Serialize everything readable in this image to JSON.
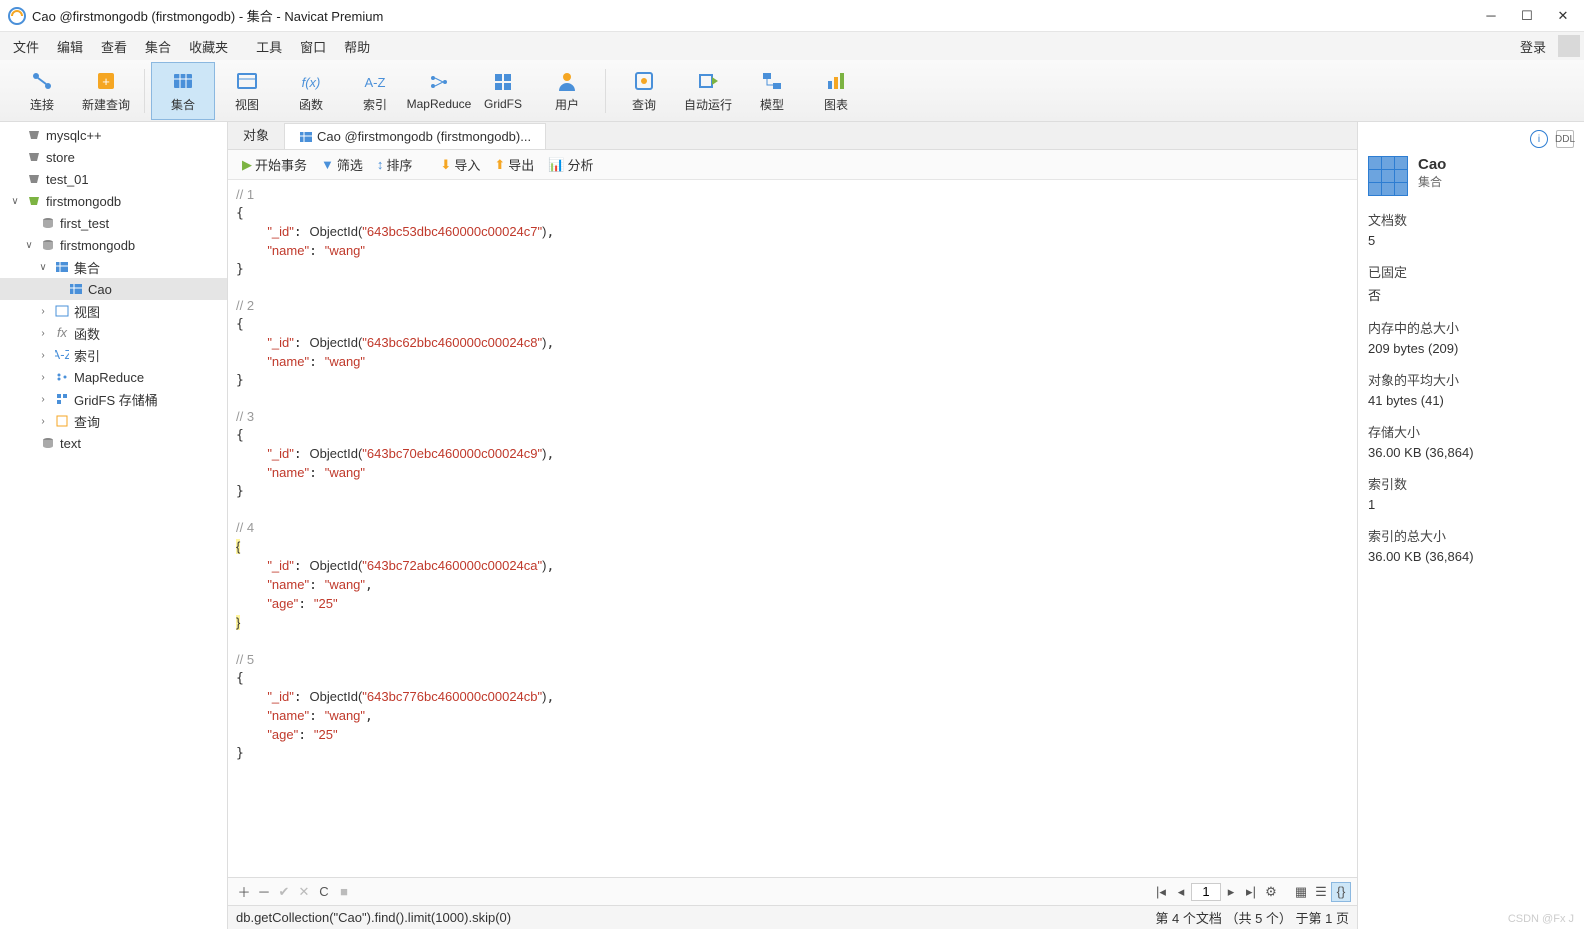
{
  "window": {
    "title": "Cao @firstmongodb (firstmongodb) - 集合 - Navicat Premium"
  },
  "menubar": {
    "items": [
      "文件",
      "编辑",
      "查看",
      "集合",
      "收藏夹",
      "工具",
      "窗口",
      "帮助"
    ],
    "login": "登录"
  },
  "toolbar": [
    {
      "label": "连接",
      "icon": "connection",
      "sep": false
    },
    {
      "label": "新建查询",
      "icon": "query-new",
      "sep": true
    },
    {
      "label": "集合",
      "icon": "collection",
      "active": true,
      "sep": false
    },
    {
      "label": "视图",
      "icon": "view",
      "sep": false
    },
    {
      "label": "函数",
      "icon": "function",
      "sep": false
    },
    {
      "label": "索引",
      "icon": "index",
      "sep": false
    },
    {
      "label": "MapReduce",
      "icon": "mapreduce",
      "sep": false
    },
    {
      "label": "GridFS",
      "icon": "gridfs",
      "sep": false
    },
    {
      "label": "用户",
      "icon": "user",
      "sep": true
    },
    {
      "label": "查询",
      "icon": "query",
      "sep": false
    },
    {
      "label": "自动运行",
      "icon": "autorun",
      "sep": false
    },
    {
      "label": "模型",
      "icon": "model",
      "sep": false
    },
    {
      "label": "图表",
      "icon": "chart",
      "sep": false
    }
  ],
  "tree": [
    {
      "label": "mysqlc++",
      "icon": "server",
      "exp": "",
      "ind": 0
    },
    {
      "label": "store",
      "icon": "server",
      "exp": "",
      "ind": 0
    },
    {
      "label": "test_01",
      "icon": "server",
      "exp": "",
      "ind": 0
    },
    {
      "label": "firstmongodb",
      "icon": "server-mongo",
      "exp": "∨",
      "ind": 0
    },
    {
      "label": "first_test",
      "icon": "db",
      "exp": "",
      "ind": 1
    },
    {
      "label": "firstmongodb",
      "icon": "db",
      "exp": "∨",
      "ind": 1
    },
    {
      "label": "集合",
      "icon": "collection",
      "exp": "∨",
      "ind": 2
    },
    {
      "label": "Cao",
      "icon": "collection",
      "exp": "",
      "ind": 3,
      "sel": true
    },
    {
      "label": "视图",
      "icon": "view",
      "exp": ">",
      "ind": 2
    },
    {
      "label": "函数",
      "icon": "function",
      "exp": ">",
      "ind": 2
    },
    {
      "label": "索引",
      "icon": "index",
      "exp": ">",
      "ind": 2
    },
    {
      "label": "MapReduce",
      "icon": "mapreduce",
      "exp": ">",
      "ind": 2
    },
    {
      "label": "GridFS 存储桶",
      "icon": "gridfs",
      "exp": ">",
      "ind": 2
    },
    {
      "label": "查询",
      "icon": "query",
      "exp": ">",
      "ind": 2
    },
    {
      "label": "text",
      "icon": "db",
      "exp": "",
      "ind": 1
    }
  ],
  "tabs": [
    {
      "label": "对象",
      "active": false
    },
    {
      "label": "Cao @firstmongodb (firstmongodb)...",
      "active": true
    }
  ],
  "subtoolbar": [
    {
      "label": "开始事务",
      "icon": "transaction"
    },
    {
      "label": "筛选",
      "icon": "filter"
    },
    {
      "label": "排序",
      "icon": "sort"
    },
    {
      "label": "导入",
      "icon": "import",
      "gap": true
    },
    {
      "label": "导出",
      "icon": "export"
    },
    {
      "label": "分析",
      "icon": "analyze"
    }
  ],
  "documents": [
    {
      "fields": [
        {
          "k": "_id",
          "fn": "ObjectId",
          "v": "643bc53dbc460000c00024c7"
        },
        {
          "k": "name",
          "v": "wang"
        }
      ]
    },
    {
      "fields": [
        {
          "k": "_id",
          "fn": "ObjectId",
          "v": "643bc62bbc460000c00024c8"
        },
        {
          "k": "name",
          "v": "wang"
        }
      ]
    },
    {
      "fields": [
        {
          "k": "_id",
          "fn": "ObjectId",
          "v": "643bc70ebc460000c00024c9"
        },
        {
          "k": "name",
          "v": "wang"
        }
      ]
    },
    {
      "fields": [
        {
          "k": "_id",
          "fn": "ObjectId",
          "v": "643bc72abc460000c00024ca"
        },
        {
          "k": "name",
          "v": "wang"
        },
        {
          "k": "age",
          "v": "25"
        }
      ],
      "hl": true
    },
    {
      "fields": [
        {
          "k": "_id",
          "fn": "ObjectId",
          "v": "643bc776bc460000c00024cb"
        },
        {
          "k": "name",
          "v": "wang"
        },
        {
          "k": "age",
          "v": "25"
        }
      ]
    }
  ],
  "pager": {
    "current": "1"
  },
  "status": {
    "query": "db.getCollection(\"Cao\").find().limit(1000).skip(0)",
    "right": "第 4 个文档 （共 5 个）  于第 1 页"
  },
  "info": {
    "name": "Cao",
    "type": "集合",
    "props": [
      {
        "label": "文档数",
        "value": "5"
      },
      {
        "label": "已固定",
        "value": "否"
      },
      {
        "label": "内存中的总大小",
        "value": "209 bytes (209)"
      },
      {
        "label": "对象的平均大小",
        "value": "41 bytes (41)"
      },
      {
        "label": "存储大小",
        "value": "36.00 KB (36,864)"
      },
      {
        "label": "索引数",
        "value": "1"
      },
      {
        "label": "索引的总大小",
        "value": "36.00 KB (36,864)"
      }
    ]
  },
  "watermark": "CSDN @Fx J"
}
